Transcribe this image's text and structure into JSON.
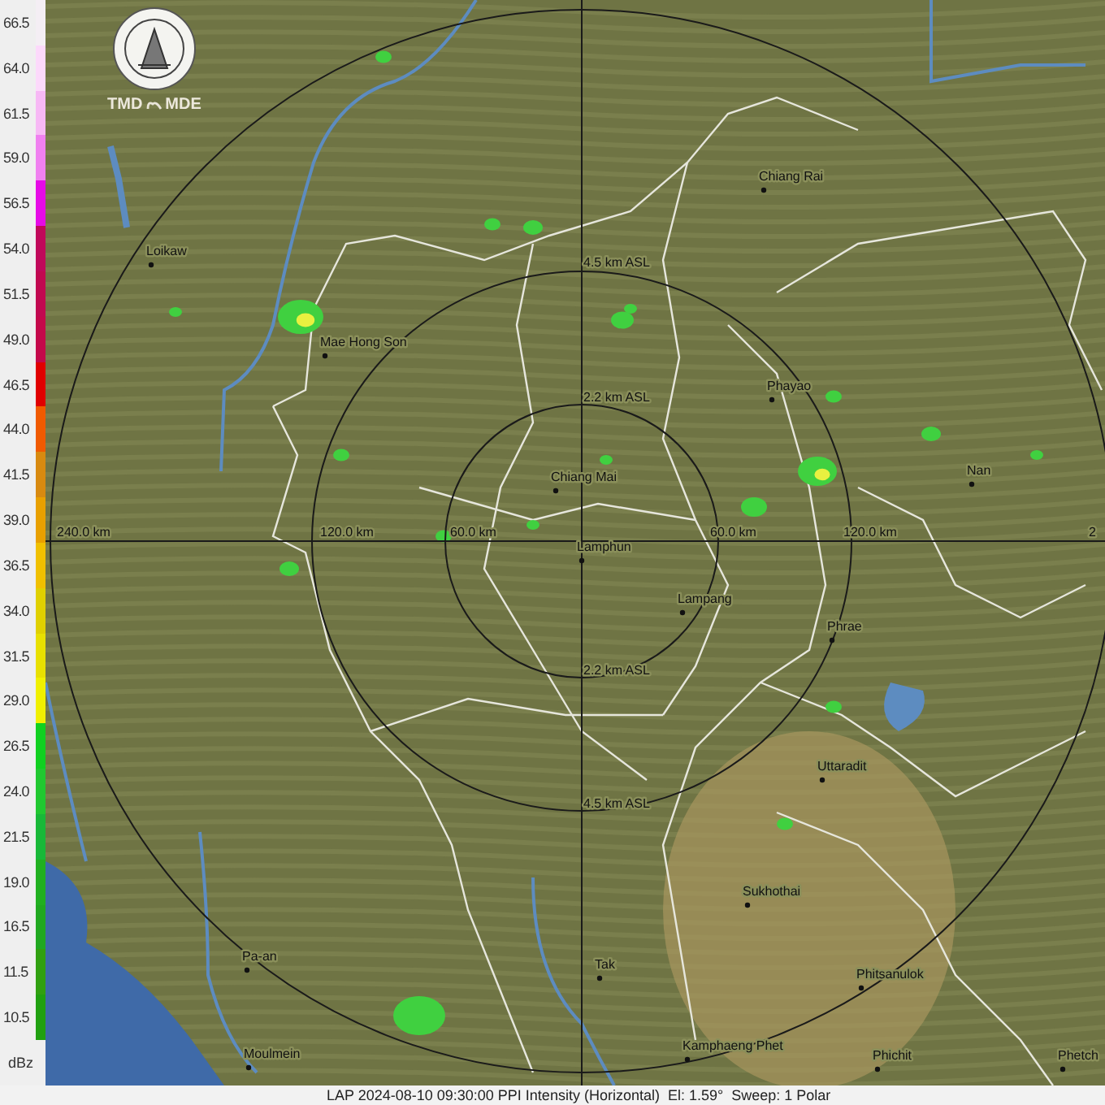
{
  "legend": {
    "unit": "dBz",
    "steps": [
      {
        "value": "66.5",
        "color": "#f4eef4"
      },
      {
        "value": "64.0",
        "color": "#fcd9fb"
      },
      {
        "value": "61.5",
        "color": "#f7b8f5"
      },
      {
        "value": "59.0",
        "color": "#f080f0"
      },
      {
        "value": "56.5",
        "color": "#e60ae6"
      },
      {
        "value": "54.0",
        "color": "#c0085a"
      },
      {
        "value": "51.5",
        "color": "#c10850"
      },
      {
        "value": "49.0",
        "color": "#c4084a"
      },
      {
        "value": "46.5",
        "color": "#e00000"
      },
      {
        "value": "44.0",
        "color": "#f05a00"
      },
      {
        "value": "41.5",
        "color": "#d88a10"
      },
      {
        "value": "39.0",
        "color": "#e8a000"
      },
      {
        "value": "36.5",
        "color": "#f0c000"
      },
      {
        "value": "34.0",
        "color": "#e0d000"
      },
      {
        "value": "31.5",
        "color": "#e8e000"
      },
      {
        "value": "29.0",
        "color": "#f0f000"
      },
      {
        "value": "26.5",
        "color": "#10d020"
      },
      {
        "value": "24.0",
        "color": "#20c830"
      },
      {
        "value": "21.5",
        "color": "#18b838"
      },
      {
        "value": "19.0",
        "color": "#20b020"
      },
      {
        "value": "16.5",
        "color": "#20a820"
      },
      {
        "value": "11.5",
        "color": "#30a010"
      },
      {
        "value": "10.5",
        "color": "#20a010"
      }
    ]
  },
  "logo": {
    "left_text": "TMD",
    "right_text": "MDE"
  },
  "map": {
    "range_labels": [
      "4.5 km ASL",
      "2.2 km ASL",
      "2.2 km ASL",
      "4.5 km ASL",
      "240.0 km",
      "120.0 km",
      "60.0 km",
      "60.0 km",
      "120.0 km",
      "2"
    ],
    "cities": [
      "Chiang Rai",
      "Loikaw",
      "Mae Hong Son",
      "Phayao",
      "Chiang Mai",
      "Nan",
      "Lamphun",
      "Lampang",
      "Phrae",
      "Uttaradit",
      "Sukhothai",
      "Tak",
      "Pa-an",
      "Phitsanulok",
      "Kamphaeng Phet",
      "Moulmein",
      "Phichit",
      "Phetch"
    ]
  },
  "caption": "LAP 2024-08-10 09:30:00 PPI Intensity (Horizontal)  El: 1.59°  Sweep: 1 Polar"
}
